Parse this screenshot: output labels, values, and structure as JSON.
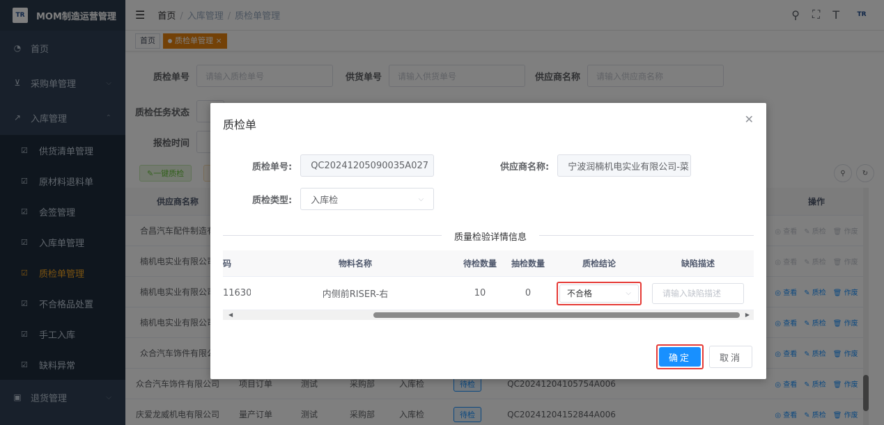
{
  "app": {
    "title": "MOM制造运营管理",
    "logo_text": "TR"
  },
  "sidebar": {
    "items": [
      {
        "label": "首页",
        "icon": "dashboard-icon"
      },
      {
        "label": "采购单管理",
        "icon": "cart-icon"
      },
      {
        "label": "入库管理",
        "icon": "external-link-icon"
      }
    ],
    "sub_items": [
      {
        "label": "供货清单管理"
      },
      {
        "label": "原材料退料单"
      },
      {
        "label": "会签管理"
      },
      {
        "label": "入库单管理"
      },
      {
        "label": "质检单管理"
      },
      {
        "label": "不合格品处置"
      },
      {
        "label": "手工入库"
      },
      {
        "label": "缺料异常"
      }
    ],
    "bottom_item": {
      "label": "退货管理"
    }
  },
  "breadcrumb": {
    "home": "首页",
    "level1": "入库管理",
    "level2": "质检单管理"
  },
  "tags": {
    "home": "首页",
    "active": "质检单管理"
  },
  "filters": {
    "order_no": {
      "label": "质检单号",
      "placeholder": "请输入质检单号"
    },
    "supply_no": {
      "label": "供货单号",
      "placeholder": "请输入供货单号"
    },
    "supplier": {
      "label": "供应商名称",
      "placeholder": "请输入供应商名称"
    },
    "task_status": {
      "label": "质检任务状态"
    },
    "report_time": {
      "label": "报检时间"
    }
  },
  "actions": {
    "one_click": "一键质检"
  },
  "table": {
    "col_supplier": "供应商名称",
    "col_ops": "操作",
    "ops": {
      "view": "查看",
      "qc": "质检",
      "void": "作废"
    },
    "rows": [
      {
        "supplier": "合昌汽车配件制造有"
      },
      {
        "supplier": "楠机电实业有限公司"
      },
      {
        "supplier": "楠机电实业有限公司"
      },
      {
        "supplier": "楠机电实业有限公司"
      },
      {
        "supplier": "众合汽车饰件有限公"
      },
      {
        "supplier": "众合汽车饰件有限公司",
        "order_type": "项目订单",
        "material": "测试",
        "dept": "采购部",
        "check_type": "入库检",
        "status": "待检",
        "qc_no": "QC20241204105754A006"
      },
      {
        "supplier": "庆爱龙威机电有限公司",
        "order_type": "量产订单",
        "material": "测试",
        "dept": "采购部",
        "check_type": "入库检",
        "status": "待检",
        "qc_no": "QC20241204152844A006"
      }
    ]
  },
  "dialog": {
    "title": "质检单",
    "qc_no_label": "质检单号:",
    "qc_no_value": "QC20241205090035A027",
    "supplier_label": "供应商名称:",
    "supplier_value": "宁波润楠机电实业有限公司-菜",
    "type_label": "质检类型:",
    "type_value": "入库检",
    "section_title": "质量检验详情信息",
    "detail": {
      "headers": {
        "code": "码",
        "name": "物料名称",
        "pending": "待检数量",
        "sample": "抽检数量",
        "result": "质检结论",
        "defect": "缺陷描述"
      },
      "row": {
        "code": "11630",
        "name": "内侧前RISER-右",
        "pending": "10",
        "sample": "0",
        "result": "不合格",
        "defect_placeholder": "请输入缺陷描述"
      }
    },
    "ok_label": "确定",
    "cancel_label": "取消"
  }
}
